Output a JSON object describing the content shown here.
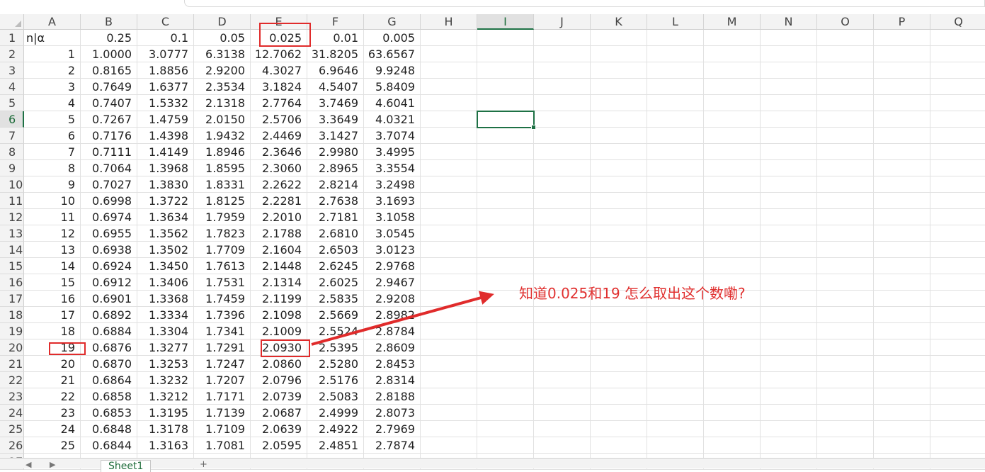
{
  "columns": [
    "A",
    "B",
    "C",
    "D",
    "E",
    "F",
    "G",
    "H",
    "I",
    "J",
    "K",
    "L",
    "M",
    "N",
    "O",
    "P",
    "Q"
  ],
  "active_column": "I",
  "active_row": 6,
  "rows": [
    [
      "n|α",
      "0.25",
      "0.1",
      "0.05",
      "0.025",
      "0.01",
      "0.005"
    ],
    [
      "1",
      "1.0000",
      "3.0777",
      "6.3138",
      "12.7062",
      "31.8205",
      "63.6567"
    ],
    [
      "2",
      "0.8165",
      "1.8856",
      "2.9200",
      "4.3027",
      "6.9646",
      "9.9248"
    ],
    [
      "3",
      "0.7649",
      "1.6377",
      "2.3534",
      "3.1824",
      "4.5407",
      "5.8409"
    ],
    [
      "4",
      "0.7407",
      "1.5332",
      "2.1318",
      "2.7764",
      "3.7469",
      "4.6041"
    ],
    [
      "5",
      "0.7267",
      "1.4759",
      "2.0150",
      "2.5706",
      "3.3649",
      "4.0321"
    ],
    [
      "6",
      "0.7176",
      "1.4398",
      "1.9432",
      "2.4469",
      "3.1427",
      "3.7074"
    ],
    [
      "7",
      "0.7111",
      "1.4149",
      "1.8946",
      "2.3646",
      "2.9980",
      "3.4995"
    ],
    [
      "8",
      "0.7064",
      "1.3968",
      "1.8595",
      "2.3060",
      "2.8965",
      "3.3554"
    ],
    [
      "9",
      "0.7027",
      "1.3830",
      "1.8331",
      "2.2622",
      "2.8214",
      "3.2498"
    ],
    [
      "10",
      "0.6998",
      "1.3722",
      "1.8125",
      "2.2281",
      "2.7638",
      "3.1693"
    ],
    [
      "11",
      "0.6974",
      "1.3634",
      "1.7959",
      "2.2010",
      "2.7181",
      "3.1058"
    ],
    [
      "12",
      "0.6955",
      "1.3562",
      "1.7823",
      "2.1788",
      "2.6810",
      "3.0545"
    ],
    [
      "13",
      "0.6938",
      "1.3502",
      "1.7709",
      "2.1604",
      "2.6503",
      "3.0123"
    ],
    [
      "14",
      "0.6924",
      "1.3450",
      "1.7613",
      "2.1448",
      "2.6245",
      "2.9768"
    ],
    [
      "15",
      "0.6912",
      "1.3406",
      "1.7531",
      "2.1314",
      "2.6025",
      "2.9467"
    ],
    [
      "16",
      "0.6901",
      "1.3368",
      "1.7459",
      "2.1199",
      "2.5835",
      "2.9208"
    ],
    [
      "17",
      "0.6892",
      "1.3334",
      "1.7396",
      "2.1098",
      "2.5669",
      "2.8982"
    ],
    [
      "18",
      "0.6884",
      "1.3304",
      "1.7341",
      "2.1009",
      "2.5524",
      "2.8784"
    ],
    [
      "19",
      "0.6876",
      "1.3277",
      "1.7291",
      "2.0930",
      "2.5395",
      "2.8609"
    ],
    [
      "20",
      "0.6870",
      "1.3253",
      "1.7247",
      "2.0860",
      "2.5280",
      "2.8453"
    ],
    [
      "21",
      "0.6864",
      "1.3232",
      "1.7207",
      "2.0796",
      "2.5176",
      "2.8314"
    ],
    [
      "22",
      "0.6858",
      "1.3212",
      "1.7171",
      "2.0739",
      "2.5083",
      "2.8188"
    ],
    [
      "23",
      "0.6853",
      "1.3195",
      "1.7139",
      "2.0687",
      "2.4999",
      "2.8073"
    ],
    [
      "24",
      "0.6848",
      "1.3178",
      "1.7109",
      "2.0639",
      "2.4922",
      "2.7969"
    ],
    [
      "25",
      "0.6844",
      "1.3163",
      "1.7081",
      "2.0595",
      "2.4851",
      "2.7874"
    ]
  ],
  "annotation": {
    "text": "知道0.025和19 怎么取出这个数嘞?",
    "color": "#e0302f"
  },
  "sheet_tabs": [
    "Sheet1"
  ],
  "colors": {
    "accent": "#1e7145",
    "highlight": "#e02b2b"
  }
}
